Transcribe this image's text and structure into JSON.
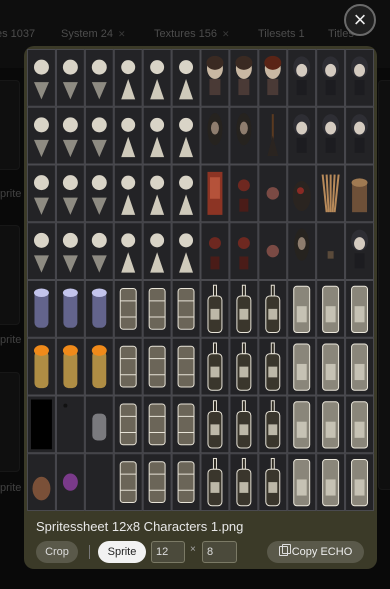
{
  "tabs": [
    {
      "label": "es 1037",
      "has_close": false
    },
    {
      "label": "System 24",
      "has_close": true
    },
    {
      "label": "Textures 156",
      "has_close": true
    },
    {
      "label": "Tilesets 1",
      "has_close": false
    },
    {
      "label": "Titles",
      "has_close": false
    }
  ],
  "background_labels": [
    "prite",
    "prite",
    "prite"
  ],
  "close_label": "×",
  "modal": {
    "filename": "Spritessheet 12x8 Characters 1.png",
    "crop_label": "Crop",
    "sprite_label": "Sprite",
    "cols_value": "12",
    "times_symbol": "×",
    "rows_value": "8",
    "copy_label": "Copy ECHO",
    "copy_icon": "copy-icon"
  },
  "sprite_grid": {
    "columns": 12,
    "rows": 8,
    "row_kinds": [
      [
        "pawn-down",
        "pawn-down",
        "pawn-down",
        "pawn-up",
        "pawn-up",
        "pawn-up",
        "girl",
        "girl",
        "girl-hat",
        "boy",
        "boy",
        "boy"
      ],
      [
        "pawn-down",
        "pawn-down",
        "pawn-down",
        "pawn-up",
        "pawn-up",
        "pawn-up",
        "dark-girl",
        "dark-girl",
        "broom",
        "boy",
        "boy",
        "boy"
      ],
      [
        "pawn-down",
        "pawn-down",
        "pawn-down",
        "pawn-up",
        "pawn-up",
        "pawn-up",
        "red-chair",
        "red-vase",
        "red-blob",
        "cauldron",
        "sticks",
        "stool"
      ],
      [
        "pawn-down",
        "pawn-down",
        "pawn-down",
        "pawn-up",
        "pawn-up",
        "pawn-up",
        "red-vase",
        "red-bits",
        "red-blob",
        "dark-girl",
        "small-box",
        "boy"
      ],
      [
        "blue-glow",
        "blue-glow",
        "blue-glow",
        "barrel",
        "barrel",
        "barrel",
        "bottle",
        "bottle",
        "bottle",
        "jar",
        "jar",
        "jar"
      ],
      [
        "fire-glow",
        "fire-glow",
        "fire-glow",
        "barrel",
        "barrel",
        "barrel",
        "bottle",
        "bottle",
        "bottle",
        "jar",
        "jar",
        "jar"
      ],
      [
        "black",
        "dark",
        "stone",
        "barrel",
        "barrel",
        "barrel",
        "bottle",
        "bottle",
        "bottle",
        "jar",
        "jar",
        "jar"
      ],
      [
        "rock",
        "purple-bits",
        "empty",
        "barrel",
        "barrel",
        "barrel",
        "bottle",
        "bottle",
        "bottle",
        "jar",
        "jar",
        "jar"
      ]
    ]
  },
  "colors": {
    "modal_bg": "#3b3a28",
    "sheet_bg": "#232326",
    "grid_line": "#4a4a4f",
    "sprite_button_bg": "#f2f2f2"
  }
}
